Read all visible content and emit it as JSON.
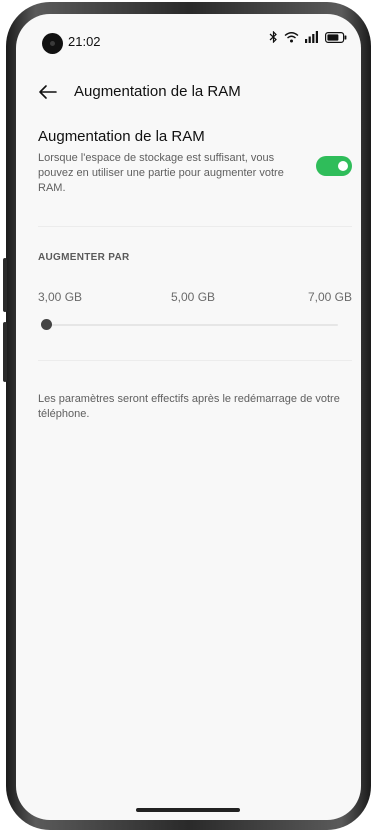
{
  "status_bar": {
    "time": "21:02",
    "icons": [
      "bluetooth-icon",
      "wifi-icon",
      "signal-icon",
      "battery-icon"
    ]
  },
  "app_bar": {
    "back_icon": "arrow-left-icon",
    "title": "Augmentation de la RAM"
  },
  "ram_expansion": {
    "title": "Augmentation de la RAM",
    "description": "Lorsque l'espace de stockage est suffisant, vous pouvez en utiliser une partie pour augmenter votre RAM.",
    "enabled": true
  },
  "increase_by": {
    "label": "AUGMENTER PAR",
    "options": [
      "3,00 GB",
      "5,00 GB",
      "7,00 GB"
    ],
    "selected": "3,00 GB",
    "slider_fraction": 0
  },
  "note": "Les paramètres seront effectifs après le redémarrage de votre téléphone.",
  "colors": {
    "accent_green": "#2fbd5a",
    "background": "#f8f8f8",
    "text_primary": "#111111",
    "text_secondary": "#5f5f5f"
  }
}
